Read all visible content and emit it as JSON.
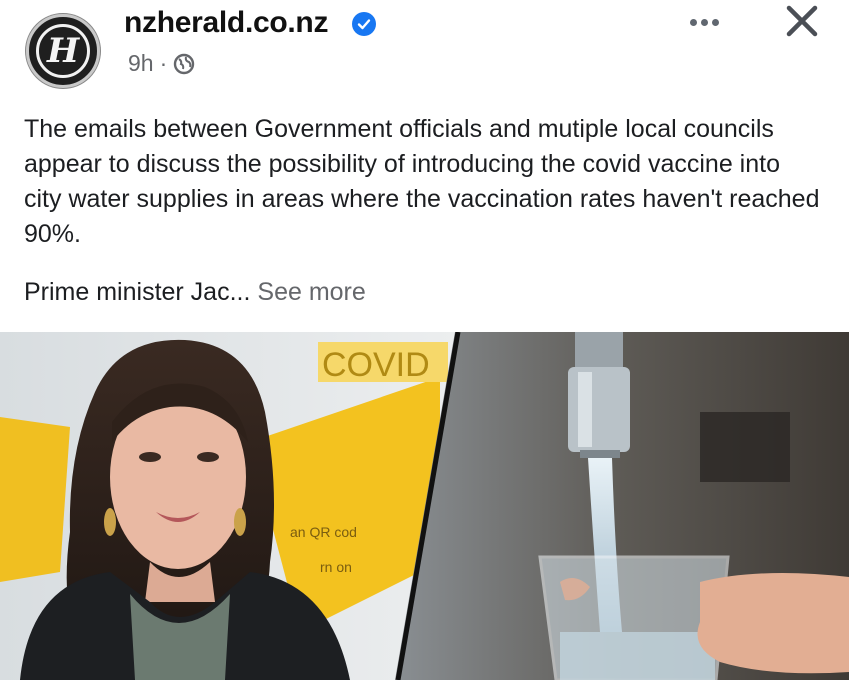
{
  "post": {
    "page_name": "nzherald.co.nz",
    "avatar_letter": "H",
    "time": "9h",
    "separator": "·",
    "icons": {
      "verified": "verified-badge-icon",
      "audience": "globe-icon",
      "more": "more-options-icon",
      "close": "close-icon"
    },
    "text": "The emails between Government officials and mutiple local councils appear to discuss the possibility of introducing the covid vaccine into city water supplies in areas where the vaccination rates haven't reached 90%.",
    "text_preview": "Prime minister Jac...",
    "see_more": "See more",
    "image": {
      "sign_text": "COVID",
      "sign_text2": "an QR cod",
      "sign_text3": "rn on"
    }
  },
  "colors": {
    "verified_blue": "#1877f2",
    "muted_text": "#65676b",
    "sign_yellow": "#f3c21f"
  }
}
